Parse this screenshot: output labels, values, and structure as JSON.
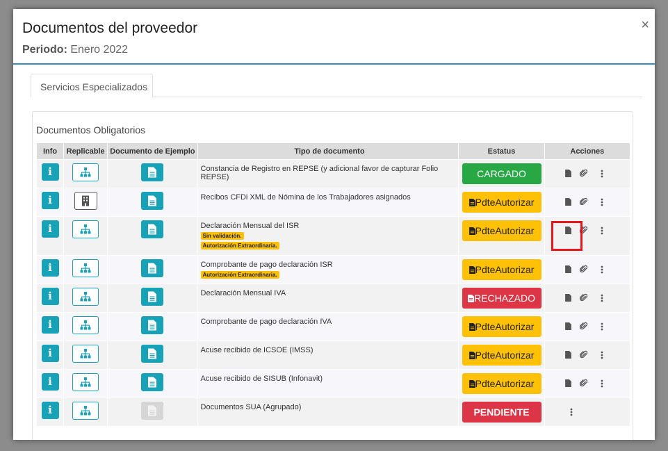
{
  "modal": {
    "title": "Documentos del proveedor",
    "period_label": "Periodo:",
    "period_value": "Enero 2022",
    "close": "×"
  },
  "tab": {
    "label": "Servicios Especializados"
  },
  "panel": {
    "title": "Documentos Obligatorios"
  },
  "table": {
    "headers": [
      "Info",
      "Replicable",
      "Documento de Ejemplo",
      "Tipo de documento",
      "Estatus",
      "Acciones"
    ],
    "rows": [
      {
        "tipo": "Constancia de Registro en REPSE (y adicional favor de capturar Folio REPSE)",
        "status": "CARGADO",
        "status_color": "#28a745",
        "badges": [],
        "replicable": "sitemap-icon",
        "example_enabled": true,
        "actions": "full"
      },
      {
        "tipo": "Recibos CFDi XML de Nómina de los Trabajadores asignados",
        "status": "PdteAutorizar",
        "status_color": "#ffc107",
        "badges": [],
        "replicable": "building-icon",
        "example_enabled": true,
        "actions": "full"
      },
      {
        "tipo": "Declaración Mensual del ISR",
        "status": "PdteAutorizar",
        "status_color": "#ffc107",
        "badges": [
          "Sin validación.",
          "Autorización Extraordinaria."
        ],
        "replicable": "sitemap-icon",
        "example_enabled": true,
        "actions": "full"
      },
      {
        "tipo": "Comprobante de pago declaración ISR",
        "status": "PdteAutorizar",
        "status_color": "#ffc107",
        "badges": [
          "Autorización Extraordinaria."
        ],
        "replicable": "sitemap-icon",
        "example_enabled": true,
        "actions": "full"
      },
      {
        "tipo": "Declaración Mensual IVA",
        "status": "RECHAZADO",
        "status_color": "#dc3545",
        "badges": [],
        "replicable": "sitemap-icon",
        "example_enabled": true,
        "actions": "full"
      },
      {
        "tipo": "Comprobante de pago declaración IVA",
        "status": "PdteAutorizar",
        "status_color": "#ffc107",
        "badges": [],
        "replicable": "sitemap-icon",
        "example_enabled": true,
        "actions": "full"
      },
      {
        "tipo": "Acuse recibido de ICSOE (IMSS)",
        "status": "PdteAutorizar",
        "status_color": "#ffc107",
        "badges": [],
        "replicable": "sitemap-icon",
        "example_enabled": true,
        "actions": "full"
      },
      {
        "tipo": "Acuse recibido de SISUB (Infonavit)",
        "status": "PdteAutorizar",
        "status_color": "#ffc107",
        "badges": [],
        "replicable": "sitemap-icon",
        "example_enabled": true,
        "actions": "full"
      },
      {
        "tipo": "Documentos SUA (Agrupado)",
        "status": "PENDIENTE",
        "status_color": "#dc3545",
        "badges": [],
        "replicable": "sitemap-icon",
        "example_enabled": false,
        "actions": "menu-only"
      }
    ]
  },
  "info_glyph": "i"
}
